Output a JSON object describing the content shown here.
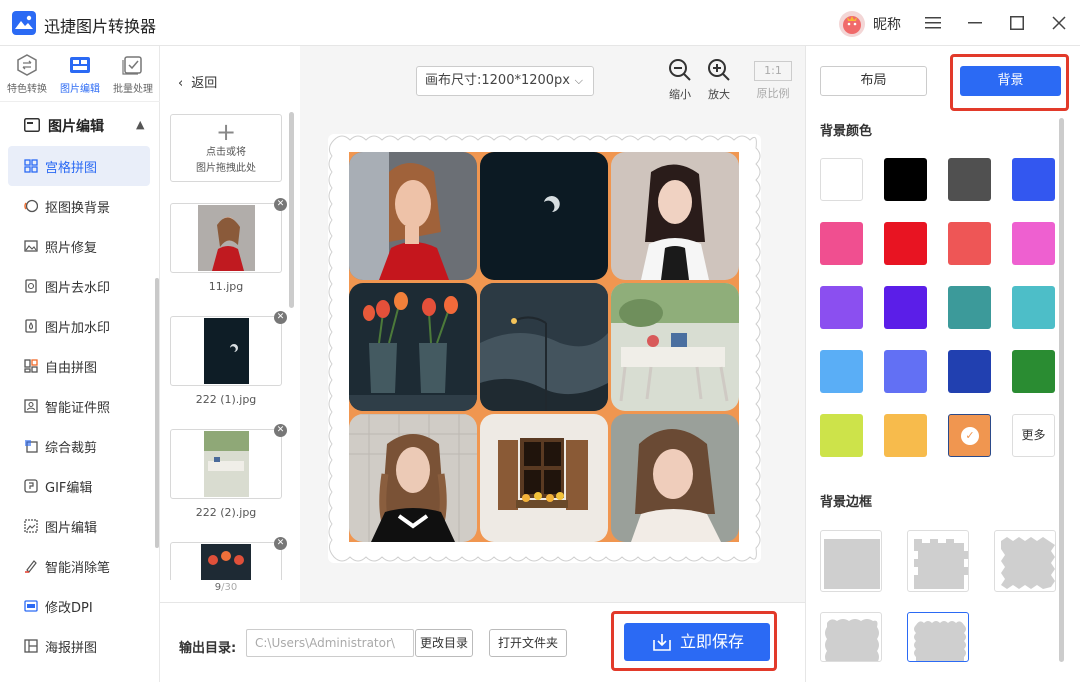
{
  "app": {
    "title": "迅捷图片转换器",
    "nickname": "昵称"
  },
  "modes": [
    {
      "label": "特色转换"
    },
    {
      "label": "图片编辑"
    },
    {
      "label": "批量处理"
    }
  ],
  "sidebar": {
    "category": "图片编辑",
    "items": [
      {
        "label": "宫格拼图"
      },
      {
        "label": "抠图换背景"
      },
      {
        "label": "照片修复"
      },
      {
        "label": "图片去水印"
      },
      {
        "label": "图片加水印"
      },
      {
        "label": "自由拼图"
      },
      {
        "label": "智能证件照"
      },
      {
        "label": "综合裁剪"
      },
      {
        "label": "GIF编辑"
      },
      {
        "label": "图片编辑"
      },
      {
        "label": "智能消除笔"
      },
      {
        "label": "修改DPI"
      },
      {
        "label": "海报拼图"
      }
    ]
  },
  "thumbs": {
    "back": "返回",
    "add_line1": "点击或将",
    "add_line2": "图片拖拽此处",
    "files": [
      {
        "name": "11.jpg"
      },
      {
        "name": "222 (1).jpg"
      },
      {
        "name": "222 (2).jpg"
      }
    ],
    "count_current": "9",
    "count_total": "/30"
  },
  "canvas": {
    "size_label": "画布尺寸:1200*1200px",
    "zoom_out": "缩小",
    "zoom_in": "放大",
    "ratio_box": "1:1",
    "ratio_label": "原比例"
  },
  "bottom": {
    "output_label": "输出目录:",
    "output_path": "C:\\Users\\Administrator\\",
    "change_dir": "更改目录",
    "open_folder": "打开文件夹",
    "save": "立即保存"
  },
  "right": {
    "tab_layout": "布局",
    "tab_background": "背景",
    "bg_color_title": "背景颜色",
    "more": "更多",
    "border_title": "背景边框",
    "selected_color": "#f09650",
    "colors": [
      "#ffffff",
      "#000000",
      "#505050",
      "#3357f0",
      "#f04f90",
      "#e81422",
      "#ee5656",
      "#ee60d0",
      "#8b4ff0",
      "#5b1ee8",
      "#3c9a9a",
      "#4dbec8",
      "#5aaef6",
      "#6270f4",
      "#2140b0",
      "#2a8c32",
      "#cde34a",
      "#f7bb4c",
      "#f09650"
    ]
  },
  "accent": "#2b6af4",
  "highlight": "#e23a2a"
}
